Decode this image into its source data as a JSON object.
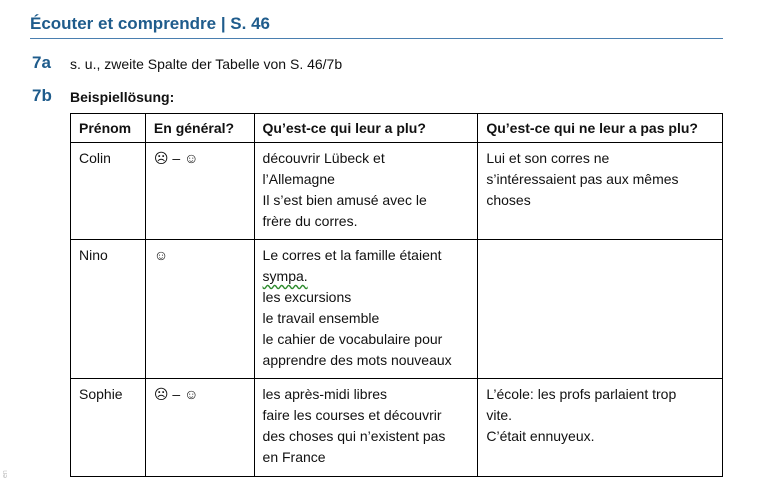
{
  "header": {
    "title": "Écouter et comprendre | S. 46"
  },
  "ex7a": {
    "number": "7a",
    "text": "s. u., zweite Spalte der Tabelle von S. 46/7b"
  },
  "ex7b": {
    "number": "7b",
    "text": "Beispiellösung:"
  },
  "table": {
    "headers": [
      "Prénom",
      "En général?",
      "Qu’est-ce qui leur a plu?",
      "Qu’est-ce qui ne leur a pas plu?"
    ],
    "rows": [
      {
        "name": "Colin",
        "general": "☹ – ☺",
        "liked": [
          "découvrir Lübeck et",
          "l’Allemagne",
          "Il s’est bien amusé avec le",
          "frère du corres."
        ],
        "disliked": [
          "Lui et son corres ne",
          "s’intéressaient pas aux mêmes",
          "choses"
        ]
      },
      {
        "name": "Nino",
        "general": "☺",
        "liked": [
          "Le corres et la famille étaient",
          "sympa.",
          "les excursions",
          "le travail ensemble",
          "le cahier de vocabulaire pour",
          "apprendre des mots nouveaux"
        ],
        "disliked": []
      },
      {
        "name": "Sophie",
        "general": "☹ – ☺",
        "liked": [
          "les après-midi libres",
          "faire les courses et découvrir",
          "des choses qui n’existent pas",
          "en France"
        ],
        "disliked": [
          "L’école: les profs parlaient trop",
          "vite.",
          "C’était ennuyeux."
        ]
      }
    ]
  },
  "margin_note": "en"
}
